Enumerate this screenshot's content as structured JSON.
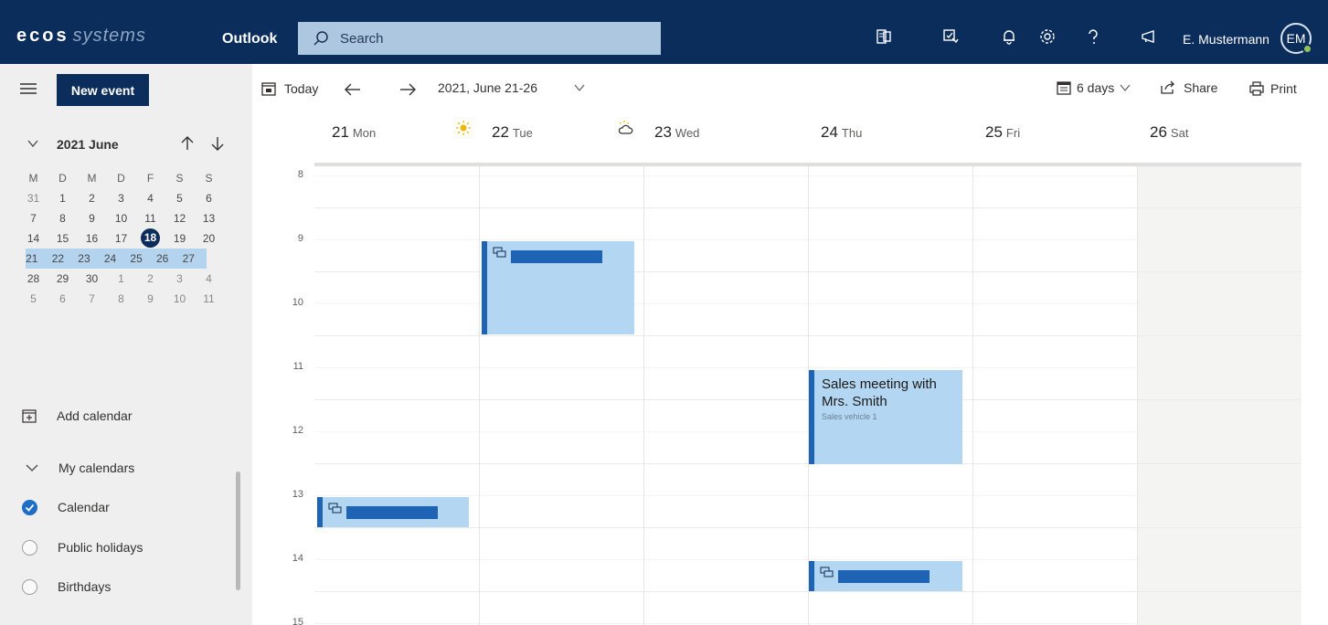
{
  "topbar": {
    "brand_bold": "ecos",
    "brand_light": "systems",
    "app_name": "Outlook",
    "search_placeholder": "Search",
    "user_name": "E. Mustermann",
    "avatar_initials": "EM",
    "icons": [
      "office-icon",
      "compose-icon",
      "bell-icon",
      "gear-icon",
      "help-icon",
      "megaphone-icon"
    ]
  },
  "sidebar": {
    "new_event_label": "New event",
    "minical": {
      "title": "2021 June",
      "weekdays": [
        "M",
        "D",
        "M",
        "D",
        "F",
        "S",
        "S"
      ],
      "weeks": [
        [
          "31",
          "1",
          "2",
          "3",
          "4",
          "5",
          "6"
        ],
        [
          "7",
          "8",
          "9",
          "10",
          "11",
          "12",
          "13"
        ],
        [
          "14",
          "15",
          "16",
          "17",
          "18",
          "19",
          "20"
        ],
        [
          "21",
          "22",
          "23",
          "24",
          "25",
          "26",
          "27"
        ],
        [
          "28",
          "29",
          "30",
          "1",
          "2",
          "3",
          "4"
        ],
        [
          "5",
          "6",
          "7",
          "8",
          "9",
          "10",
          "11"
        ]
      ],
      "today": "18",
      "selected_week": 3
    },
    "add_calendar_label": "Add calendar",
    "my_calendars_label": "My calendars",
    "calendars": [
      {
        "label": "Calendar",
        "checked": true
      },
      {
        "label": "Public holidays",
        "checked": false
      },
      {
        "label": "Birthdays",
        "checked": false
      }
    ]
  },
  "toolbar": {
    "today_label": "Today",
    "range_label": "2021, June 21-26",
    "view_label": "6 days",
    "share_label": "Share",
    "print_label": "Print"
  },
  "calendar": {
    "days": [
      {
        "num": "21",
        "name": "Mon",
        "weather": "sun-icon"
      },
      {
        "num": "22",
        "name": "Tue",
        "weather": "partly-cloudy-icon"
      },
      {
        "num": "23",
        "name": "Wed"
      },
      {
        "num": "24",
        "name": "Thu"
      },
      {
        "num": "25",
        "name": "Fri"
      },
      {
        "num": "26",
        "name": "Sat"
      }
    ],
    "hours": [
      "8",
      "9",
      "10",
      "11",
      "12",
      "13",
      "14",
      "15"
    ],
    "events": [
      {
        "day": "22",
        "start": "9:00",
        "end": "10:30",
        "title": "",
        "location": "",
        "redacted": true
      },
      {
        "day": "24",
        "start": "11:00",
        "end": "12:30",
        "title": "Sales meeting with Mrs. Smith",
        "location": "Sales vehicle 1",
        "redacted": false
      },
      {
        "day": "21",
        "start": "13:00",
        "end": "13:30",
        "title": "",
        "location": "",
        "redacted": true
      },
      {
        "day": "24",
        "start": "14:00",
        "end": "14:30",
        "title": "",
        "location": "",
        "redacted": true
      }
    ]
  },
  "colors": {
    "header_bg": "#0b2d5b",
    "search_bg": "#aec7e0",
    "event_bg": "#b3d6f2",
    "event_accent": "#1f64b4",
    "selection": "#b3d3ee"
  }
}
